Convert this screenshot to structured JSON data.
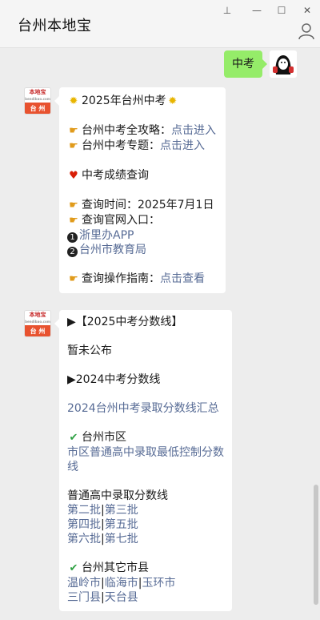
{
  "window": {
    "title": "台州本地宝",
    "pin_glyph": "⊥",
    "min_glyph": "—",
    "max_glyph": "☐",
    "close_glyph": "✕"
  },
  "outgoing": {
    "text": "中考"
  },
  "avatar_brand": {
    "name": "本地宝",
    "site": "bendibao.com",
    "city": "台 州"
  },
  "message1": {
    "headline": "2025年台州中考",
    "guide_label": "台州中考全攻略：",
    "guide_link": "点击进入",
    "topic_label": "台州中考专题：",
    "topic_link": "点击进入",
    "score_query": "中考成绩查询",
    "query_time": "查询时间：2025年7月1日",
    "query_entry": "查询官网入口：",
    "entry1_num": "1",
    "entry1": "浙里办APP",
    "entry2_num": "2",
    "entry2": "台州市教育局",
    "howto_label": "查询操作指南：",
    "howto_link": "点击查看"
  },
  "message2": {
    "heading_2025": "▶【2025中考分数线】",
    "not_published": "暂未公布",
    "heading_2024": "▶2024中考分数线",
    "summary_link": "2024台州中考录取分数线汇总",
    "city_district": "台州市区",
    "city_link_line1": "市区普通高中录取最低控制分数",
    "city_link_line2": "线",
    "general_label": "普通高中录取分数线",
    "batch_row1": [
      "第二批",
      "第三批"
    ],
    "batch_row2": [
      "第四批",
      "第五批"
    ],
    "batch_row3": [
      "第六批",
      "第七批"
    ],
    "sep": "|",
    "other_counties": "台州其它市县",
    "county_row1": [
      "温岭市",
      "临海市",
      "玉环市"
    ],
    "county_row2": [
      "三门县",
      "天台县"
    ]
  }
}
